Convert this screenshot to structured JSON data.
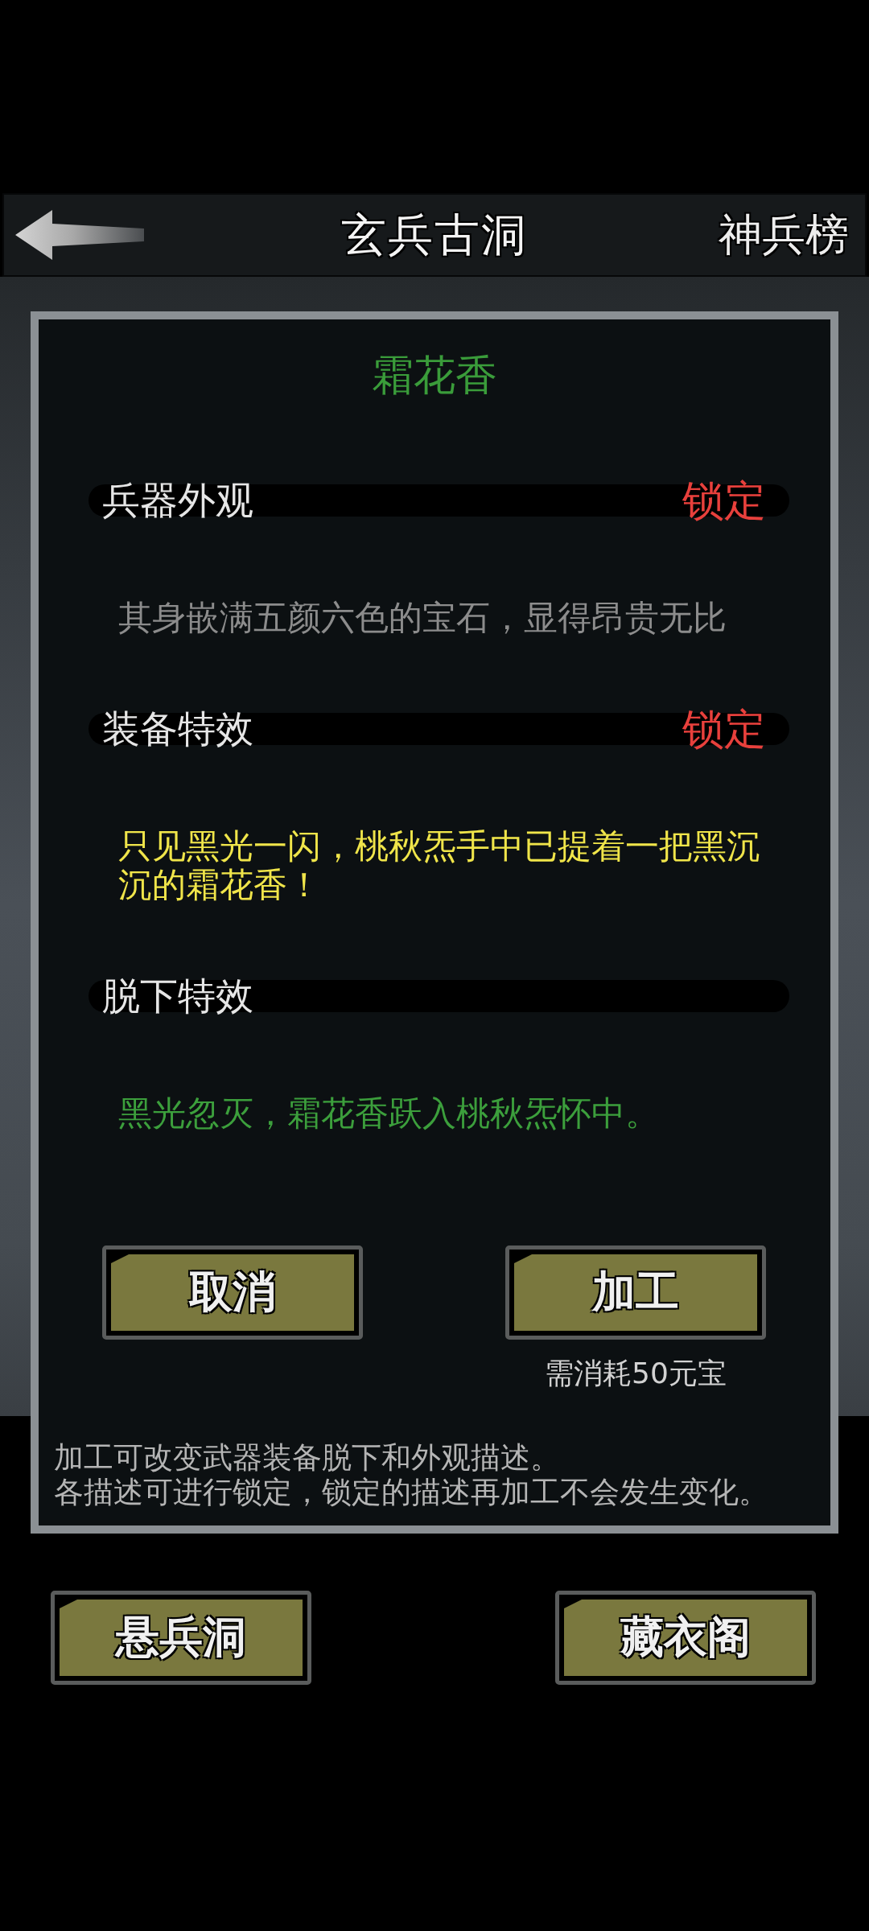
{
  "header": {
    "title": "玄兵古洞",
    "right_button": "神兵榜"
  },
  "dialog": {
    "title": "霜花香",
    "sections": [
      {
        "label": "兵器外观",
        "lock_button": "锁定",
        "description": "其身嵌满五颜六色的宝石，显得昂贵无比",
        "color": "#8c8c8c"
      },
      {
        "label": "装备特效",
        "lock_button": "锁定",
        "description": "只见黑光一闪，桃秋炁手中已提着一把黑沉沉的霜花香！",
        "color": "#f0e54a"
      },
      {
        "label": "脱下特效",
        "description": "黑光忽灭，霜花香跃入桃秋炁怀中。",
        "color": "#3c9f3c"
      }
    ],
    "buttons": [
      {
        "label": "取消"
      },
      {
        "label": "加工",
        "cost": "需消耗50元宝"
      }
    ],
    "notes": [
      "加工可改变武器装备脱下和外观描述。",
      "各描述可进行锁定，锁定的描述再加工不会发生变化。"
    ]
  },
  "bottom_buttons": [
    {
      "label": "悬兵洞"
    },
    {
      "label": "藏衣阁"
    }
  ]
}
